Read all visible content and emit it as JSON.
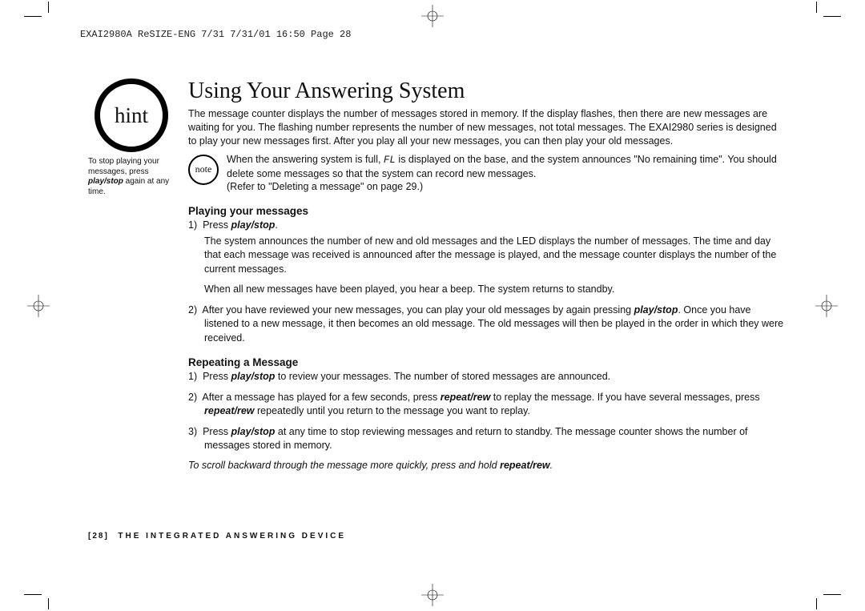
{
  "slug": "EXAI2980A ReSIZE-ENG 7/31  7/31/01  16:50  Page 28",
  "hint": {
    "badge": "hint",
    "text_pre": "To stop playing your messages, press ",
    "text_ps": "play/stop",
    "text_post": " again at any time."
  },
  "title": "Using Your Answering System",
  "intro": "The message counter displays the number of messages stored in memory. If the display flashes, then there are new messages are waiting for you. The flashing number represents the number of new messages, not total messages. The EXAI2980 series is designed to play your new messages first. After you play all your new messages, you can then play your old messages.",
  "note": {
    "badge": "note",
    "line1_a": "When the answering system is full, ",
    "fl": "FL",
    "line1_b": " is displayed on the base, and the system announces \"No remaining time\". You should delete some messages so that the system can record new messages.",
    "line2": "(Refer to \"Deleting a message\" on page 29.)"
  },
  "sec1": {
    "heading": "Playing your messages",
    "step1_a": "Press ",
    "step1_ps": "play/stop",
    "step1_b": ".",
    "step1_p1": "The system announces the number of new and old messages and the LED displays the number of messages. The time and day that each message was received is announced after the message is played, and the message counter displays the number of the current messages.",
    "step1_p2": "When all new messages have been played, you hear a beep. The system returns to standby.",
    "step2_a": "After you have reviewed your new messages, you can play your old messages by again pressing ",
    "step2_ps": "play/stop",
    "step2_b": ". Once you have listened to a new message, it then becomes an old message. The old messages will then be played in the order in which they were received."
  },
  "sec2": {
    "heading": "Repeating a Message",
    "s1_a": "Press ",
    "s1_ps": "play/stop",
    "s1_b": " to review your messages. The number of stored messages are announced.",
    "s2_a": "After a message has played for a few seconds, press ",
    "s2_ps1": "repeat/rew",
    "s2_b": " to replay the message. If you have several messages, press ",
    "s2_ps2": "repeat/rew",
    "s2_c": " repeatedly until you return to the message you want to replay.",
    "s3_a": "Press ",
    "s3_ps": "play/stop",
    "s3_b": " at any time to stop reviewing messages and return to standby. The message counter shows the number of messages stored in memory.",
    "tip_a": "To scroll backward through the message more quickly, press and hold ",
    "tip_ps": "repeat/rew",
    "tip_b": "."
  },
  "footer": {
    "page": "[28]",
    "label": "THE INTEGRATED ANSWERING DEVICE"
  }
}
